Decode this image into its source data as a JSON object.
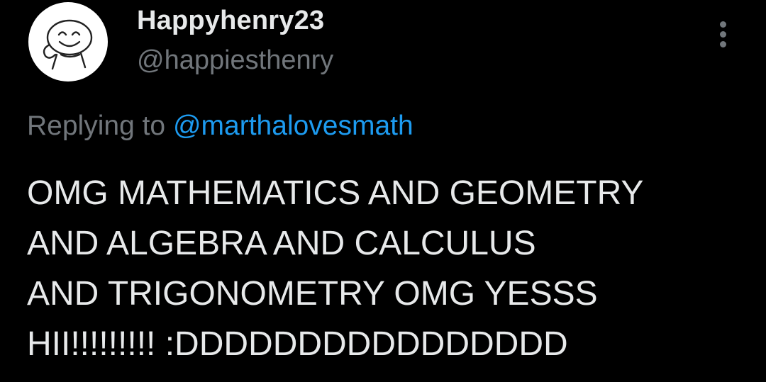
{
  "tweet": {
    "author": {
      "display_name": "Happyhenry23",
      "handle": "@happiesthenry",
      "avatar_icon": "smiley-doodle-avatar"
    },
    "more_icon": "vertical-ellipsis-icon",
    "reply_prefix": "Replying to",
    "reply_mention": "@marthalovesmath",
    "body_lines": [
      "OMG MATHEMATICS AND GEOMETRY",
      "AND ALGEBRA AND CALCULUS",
      "AND TRIGONOMETRY OMG YESSS",
      "HII!!!!!!!!! :DDDDDDDDDDDDDDDD"
    ]
  },
  "colors": {
    "background": "#000000",
    "primary_text": "#e7e9ea",
    "secondary_text": "#71767b",
    "link": "#1d9bf0"
  }
}
